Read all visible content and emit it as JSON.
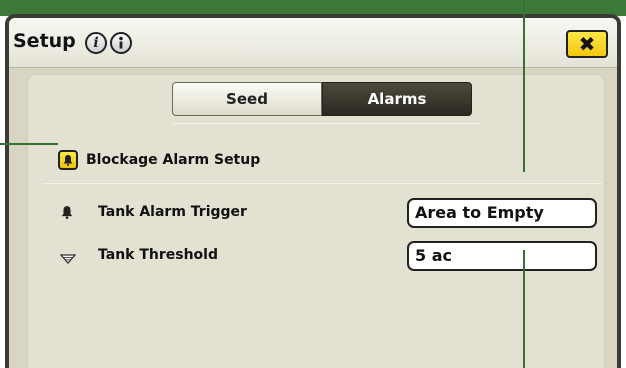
{
  "dialog": {
    "title": "Setup",
    "info_icons": [
      "info-icon",
      "help-icon"
    ],
    "close_label": "✖"
  },
  "tabs": [
    {
      "label": "Seed",
      "selected": false
    },
    {
      "label": "Alarms",
      "selected": true
    }
  ],
  "section": {
    "title": "Blockage Alarm Setup",
    "icon": "bell-icon"
  },
  "rows": [
    {
      "label": "Tank Alarm Trigger",
      "icon": "bell-icon",
      "value": "Area to Empty"
    },
    {
      "label": "Tank Threshold",
      "icon": "gauge-icon",
      "value": "5 ac"
    }
  ],
  "colors": {
    "accent_yellow": "#f5d020",
    "frame_green": "#3d7a3a",
    "tab_selected": "#2f2b22"
  }
}
